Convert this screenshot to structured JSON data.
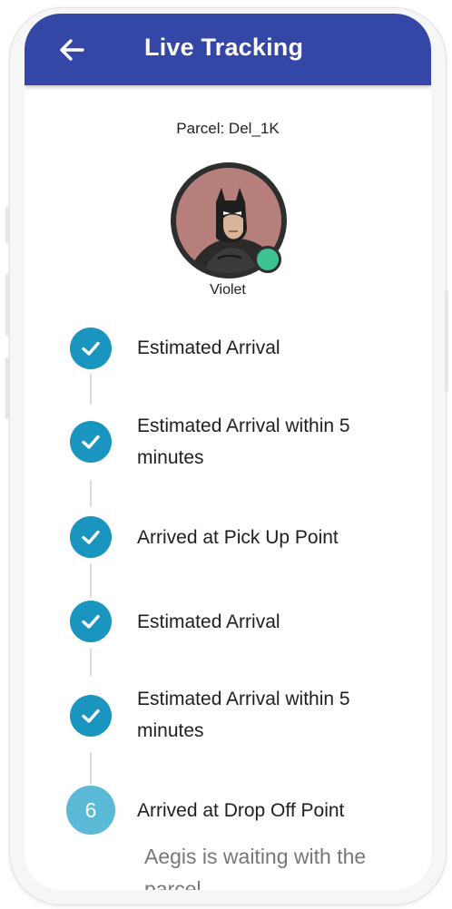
{
  "app_bar": {
    "title": "Live Tracking",
    "back_icon": "arrow-left-icon",
    "background": "#3446a6"
  },
  "parcel": {
    "label": "Parcel: Del_1K"
  },
  "courier": {
    "name": "Violet",
    "avatar_icon": "batman-avatar",
    "status": "online",
    "status_color": "#3ec28f"
  },
  "steps": [
    {
      "label": "Estimated Arrival",
      "state": "done"
    },
    {
      "label": "Estimated Arrival within 5 minutes",
      "state": "done"
    },
    {
      "label": "Arrived at Pick Up Point",
      "state": "done"
    },
    {
      "label": "Estimated Arrival",
      "state": "done"
    },
    {
      "label": "Estimated Arrival within 5 minutes",
      "state": "done"
    },
    {
      "label": "Arrived at Drop Off Point",
      "state": "pending",
      "number": "6",
      "sub": "Aegis is waiting with the parcel"
    }
  ],
  "colors": {
    "step_done": "#1a95bf",
    "step_pending": "#5ab9d6"
  }
}
